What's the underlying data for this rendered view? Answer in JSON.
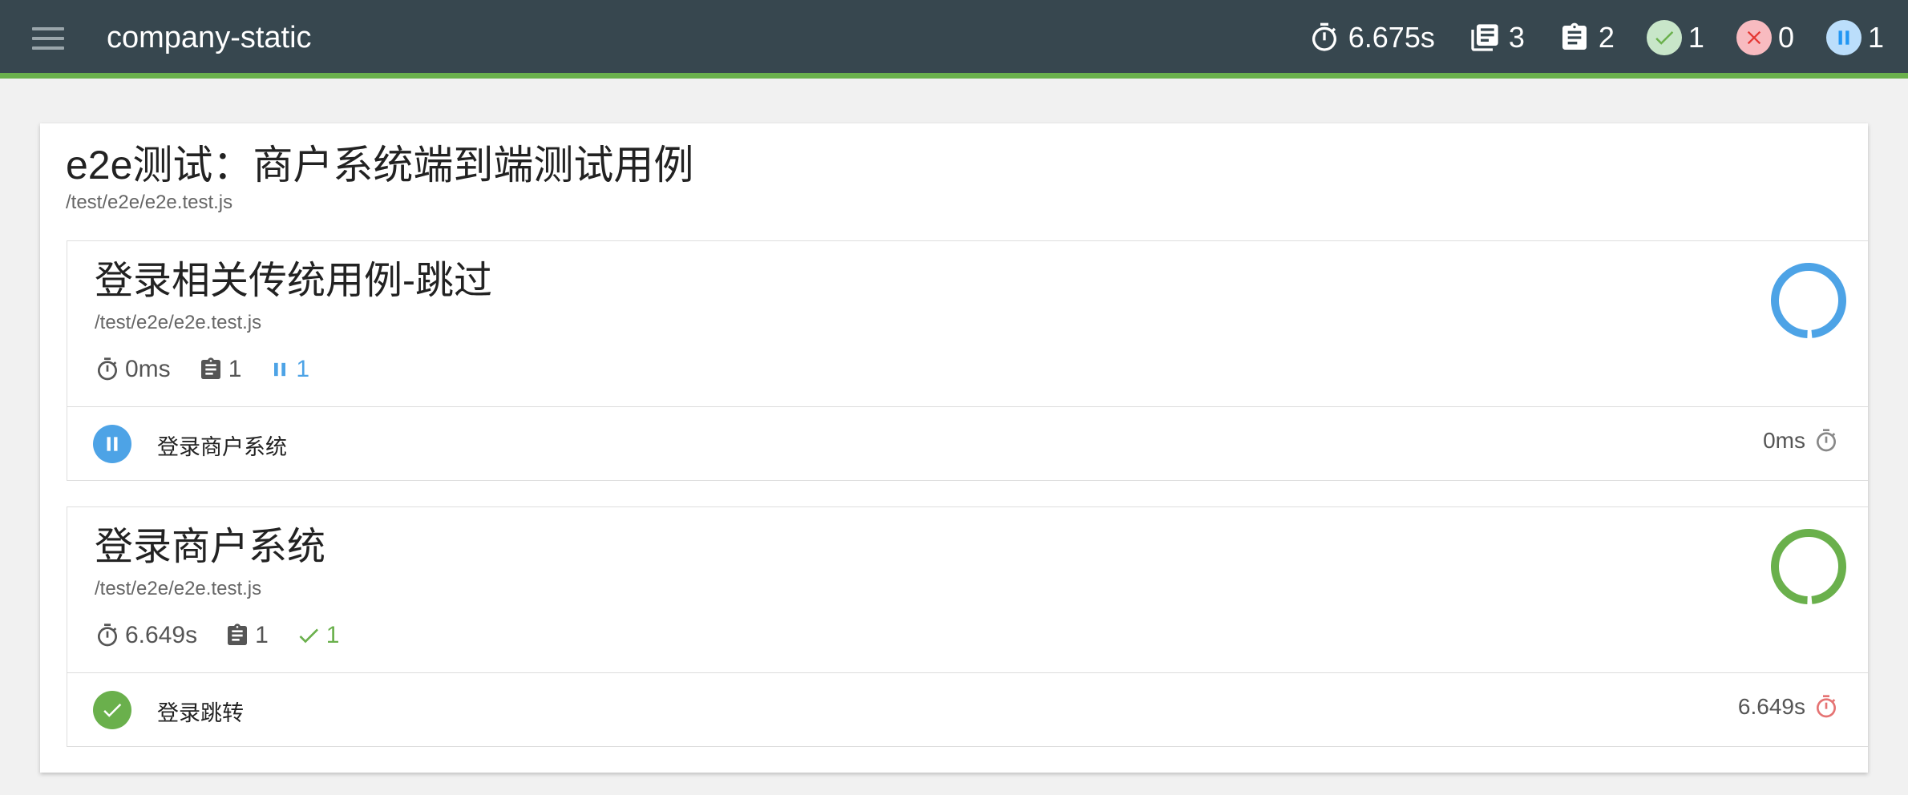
{
  "header": {
    "title": "company-static",
    "duration": "6.675s",
    "suites": "3",
    "tests": "2",
    "passed": "1",
    "failed": "0",
    "pending": "1"
  },
  "suite": {
    "title": "e2e测试：商户系统端到端测试用例",
    "path": "/test/e2e/e2e.test.js"
  },
  "blocks": [
    {
      "title": "登录相关传统用例-跳过",
      "path": "/test/e2e/e2e.test.js",
      "duration": "0ms",
      "tests": "1",
      "status_count": "1",
      "status": "pending",
      "tests_list": [
        {
          "name": "登录商户系统",
          "duration": "0ms"
        }
      ]
    },
    {
      "title": "登录商户系统",
      "path": "/test/e2e/e2e.test.js",
      "duration": "6.649s",
      "tests": "1",
      "status_count": "1",
      "status": "passed",
      "tests_list": [
        {
          "name": "登录跳转",
          "duration": "6.649s"
        }
      ]
    }
  ],
  "colors": {
    "navbar": "#37474f",
    "accent_green": "#6ab04c",
    "pending_blue": "#4da3e6",
    "passed_green": "#6ab04c",
    "failed_red": "#e57373"
  },
  "icons": {
    "duration": "stopwatch-icon",
    "suites": "library-books-icon",
    "tests": "clipboard-icon",
    "passed": "check-icon",
    "failed": "close-icon",
    "pending": "pause-icon"
  }
}
